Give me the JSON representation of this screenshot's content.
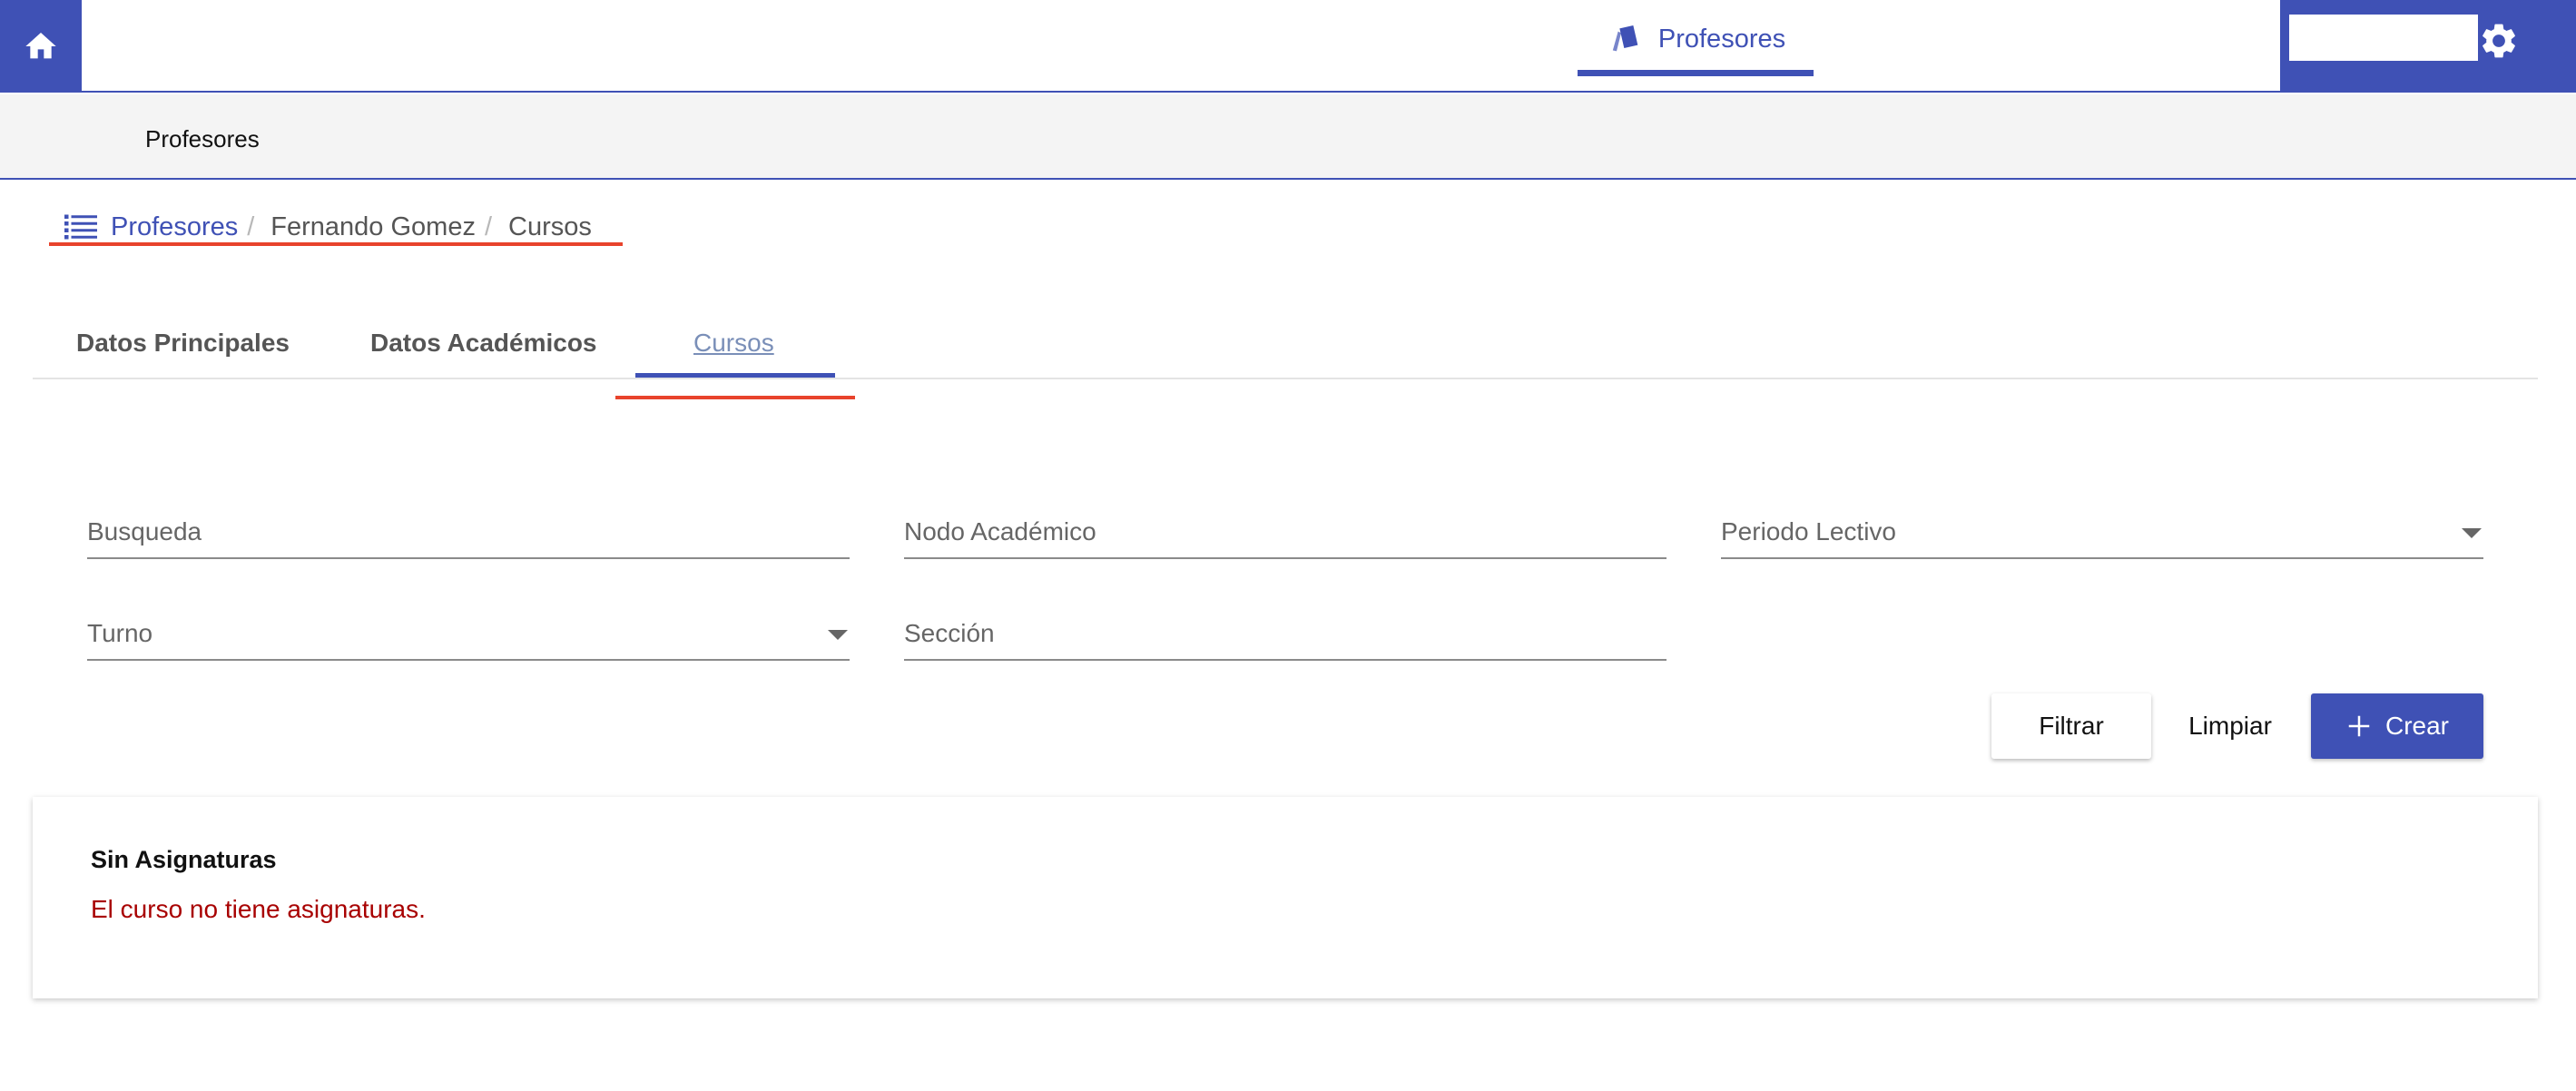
{
  "topbar": {
    "nav_tab_label": "Profesores",
    "home_icon": "home-icon",
    "nav_icon": "cards-icon",
    "settings_icon": "gear-icon",
    "accent": "#3f51b5"
  },
  "subheader": {
    "title": "Profesores"
  },
  "breadcrumb": {
    "items": [
      {
        "label": "Profesores",
        "icon": "list-icon"
      },
      {
        "label": "Fernando Gomez"
      },
      {
        "label": "Cursos"
      }
    ],
    "separator": "/"
  },
  "tabs": [
    {
      "label": "Datos Principales"
    },
    {
      "label": "Datos Académicos"
    },
    {
      "label": "Cursos",
      "active": true
    }
  ],
  "filters": {
    "busqueda": {
      "placeholder": "Busqueda"
    },
    "nodo": {
      "placeholder": "Nodo Académico"
    },
    "periodo": {
      "placeholder": "Periodo Lectivo"
    },
    "turno": {
      "placeholder": "Turno"
    },
    "seccion": {
      "placeholder": "Sección"
    }
  },
  "actions": {
    "filtrar": "Filtrar",
    "limpiar": "Limpiar",
    "crear": "Crear",
    "crear_icon": "plus-icon"
  },
  "empty_state": {
    "title": "Sin Asignaturas",
    "message": "El curso no tiene asignaturas.",
    "message_color": "#a80000"
  }
}
